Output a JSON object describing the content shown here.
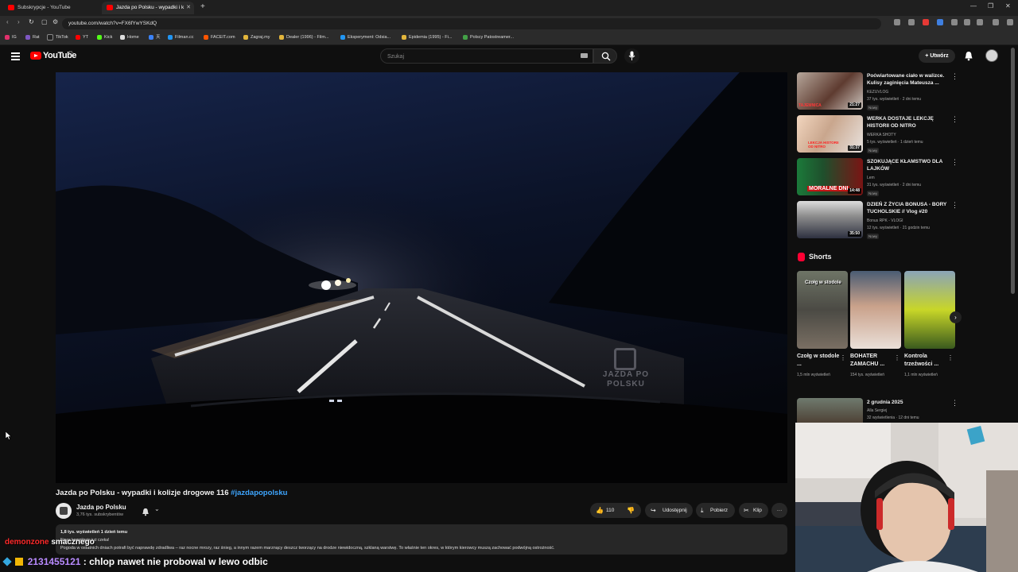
{
  "browser": {
    "tabs": [
      {
        "label": "Subskrypcje - YouTube"
      },
      {
        "label": "Jazda po Polsku - wypadki i k"
      }
    ],
    "new_tab": "+",
    "url": "youtube.com/watch?v=FX6fYwYSKdQ",
    "bookmarks": [
      "IG",
      "Rat",
      "TikTok",
      "YT",
      "Kick",
      "Home",
      "天",
      "Filman.cc",
      "FACEIT.com",
      "Zagraj.my",
      "Dealer (1996) - Film...",
      "Eksperyment: Odsia...",
      "Epidemia (1995) - Fi...",
      "Polscy Patostreamer..."
    ]
  },
  "yt": {
    "logo": "YouTube",
    "logo_country": "PL",
    "search_placeholder": "Szukaj",
    "create_label": "Utwórz"
  },
  "video": {
    "title": "Jazda po Polsku - wypadki i kolizje drogowe 116",
    "hashtag": "#jazdapopolsku",
    "watermark": "JAZDA PO POLSKU",
    "channel": "Jazda po Polsku",
    "subscribers": "3,76 tys. subskrybentów",
    "likes": "110",
    "share": "Udostępnij",
    "download": "Pobierz",
    "clip": "Klip",
    "more": "···",
    "views_date": "1,8 tys. wyświetleń  1 dzień temu",
    "desc_line2": "Nowa kompilacja już czeka!",
    "description": "Pogoda w ostatnich dniach potrafi być naprawdę zdradliwa – raz nocne mrozy, raz śnieg, a innym razem marznący deszcz tworzący na drodze niewidoczną, szklaną warstwę. To właśnie ten okres, w którym kierowcy muszą zachować podwójną ostrożność."
  },
  "recommendations": [
    {
      "title": "Poćwiartowane ciało w walizce. Kulisy zaginięcia Mateusza ...",
      "channel": "KEZUVLOG",
      "meta": "37 tys. wyświetleń · 2 dni temu",
      "badge": "Nowy",
      "duration": "21:27"
    },
    {
      "title": "WERKA DOSTAJE LEKCJĘ HISTORII OD NITRO",
      "channel": "WERKA SHOTY",
      "meta": "5 tys. wyświetleń · 1 dzień temu",
      "badge": "Nowy",
      "duration": "31:37"
    },
    {
      "title": "SZOKUJĄCE KŁAMSTWO DLA LAJKÓW",
      "channel": "Lem",
      "meta": "31 tys. wyświetleń · 2 dni temu",
      "badge": "Nowy",
      "duration": "14:48"
    },
    {
      "title": "DZIEŃ Z ŻYCIA BONUSA - BORY TUCHOLSKIE // Vlog #20",
      "channel": "Bonus RPK - VLOGI",
      "meta": "12 tys. wyświetleń · 21 godzin temu",
      "badge": "Nowy",
      "duration": "35:50"
    }
  ],
  "thumb_text": {
    "r1": "TAJEMNICA",
    "r2": "LEKCJA HISTORII OD NITRO",
    "r3": "MORALNE DNI"
  },
  "shorts": {
    "heading": "Shorts",
    "items": [
      {
        "title": "Czołg w stodole ...",
        "views": "1,5 mln wyświetleń",
        "thumb_text": "Czołg w stodole"
      },
      {
        "title": "BOHATER ZAMACHU ...",
        "views": "154 tys. wyświetleń"
      },
      {
        "title": "Kontrola trzeźwości ...",
        "views": "1,1 mln wyświetleń"
      }
    ]
  },
  "rec5": {
    "title": "2 grudnia 2025",
    "channel": "Alla Sergiej",
    "meta": "32 wyświetlenia · 12 dni temu"
  },
  "chat": [
    {
      "user": "demonzone",
      "message": "smacznego"
    },
    {
      "user": "2131455121",
      "message": ": chlop nawet nie probowal w lewo odbic"
    }
  ]
}
